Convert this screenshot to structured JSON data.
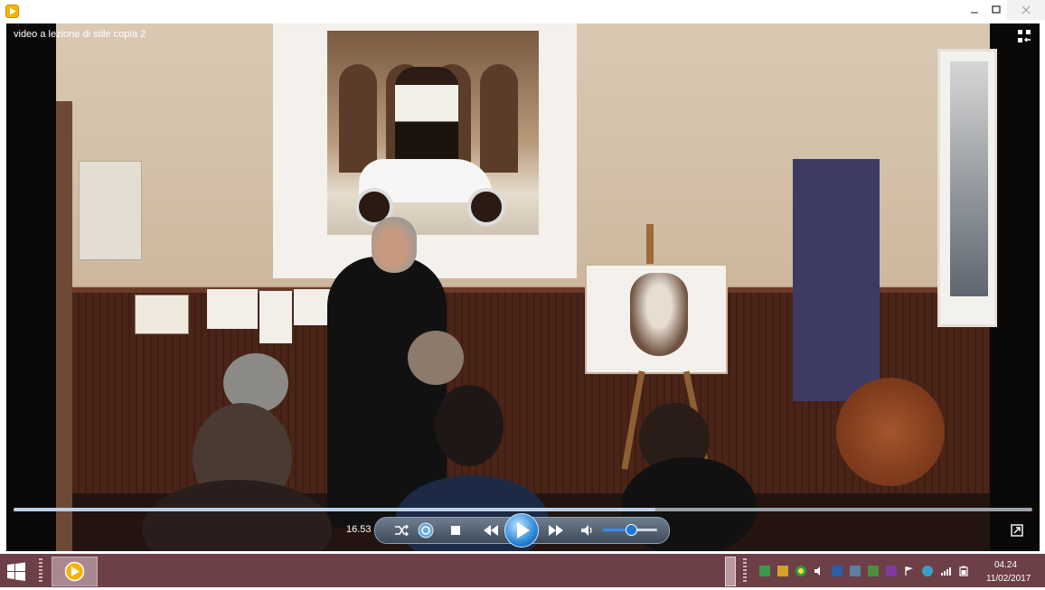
{
  "window": {
    "title": "video a lezione di stile copia 2",
    "controls": [
      "minimize",
      "maximize",
      "close"
    ]
  },
  "player": {
    "current_time": "16.53",
    "progress_fraction": 0.63,
    "volume_fraction": 0.52,
    "controls": [
      "shuffle",
      "repeat",
      "stop",
      "previous",
      "play",
      "next",
      "mute"
    ],
    "icons": {
      "fullscreen": "fullscreen-toggle-icon",
      "switch": "switch-to-library-icon"
    }
  },
  "taskbar": {
    "clock": {
      "time": "04.24",
      "date": "11/02/2017"
    },
    "tray_icons": [
      "app-icon-1",
      "app-icon-2",
      "chrome-icon",
      "speaker-icon",
      "app-icon-3",
      "network-icon",
      "app-icon-4",
      "onenote-icon",
      "flag-icon",
      "app-icon-5",
      "signal-icon",
      "battery-icon"
    ]
  },
  "colors": {
    "taskbar": "#6d3f47",
    "play_accent": "#2b86d8"
  }
}
